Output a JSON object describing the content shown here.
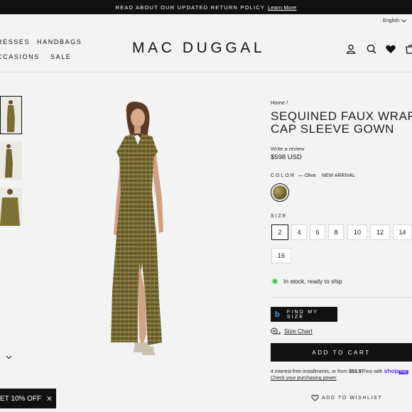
{
  "announcement": {
    "text": "READ ABOUT OUR UPDATED RETURN POLICY",
    "link": "Learn More"
  },
  "header": {
    "language": "English",
    "nav": [
      "RESSES",
      "HANDBAGS",
      "CCASIONS",
      "SALE"
    ],
    "logo": "MAC DUGGAL",
    "icons": [
      "account-icon",
      "search-icon",
      "heart-icon",
      "cart-icon"
    ]
  },
  "gallery": {
    "thumbnails": 3,
    "selected_index": 0
  },
  "product": {
    "breadcrumb": "Home /",
    "title_line1": "SEQUINED FAUX WRAP",
    "title_line2": "CAP SLEEVE GOWN",
    "review": "Write a review",
    "price": "$598 USD",
    "color_label": "COLOR",
    "color_value": "— Olive",
    "color_badge": "NEW ARRIVAL",
    "swatch_color": "#6d6530",
    "size_label": "SIZE",
    "sizes": [
      "2",
      "4",
      "6",
      "8",
      "10",
      "12",
      "14",
      "16"
    ],
    "selected_size": "2",
    "stock": "In stock, ready to ship",
    "find_my_size": "FIND MY SIZE",
    "find_my_size_logo": "b",
    "size_chart": "Size Chart",
    "add_to_cart": "ADD TO CART",
    "installments_prefix": "4 interest-free installments, or from ",
    "installments_amount": "$53.97",
    "installments_suffix": "/mo with ",
    "shop_brand": "shop",
    "shop_pay": "Pay",
    "check_power": "Check your purchasing power",
    "wishlist": "ADD TO WISHLIST"
  },
  "promo": {
    "text": "ET 10% OFF"
  },
  "colors": {
    "dark": "#111111",
    "background": "#f3f3f3",
    "stock_dot": "#4cb84c",
    "shop_pay": "#5a31f4"
  }
}
